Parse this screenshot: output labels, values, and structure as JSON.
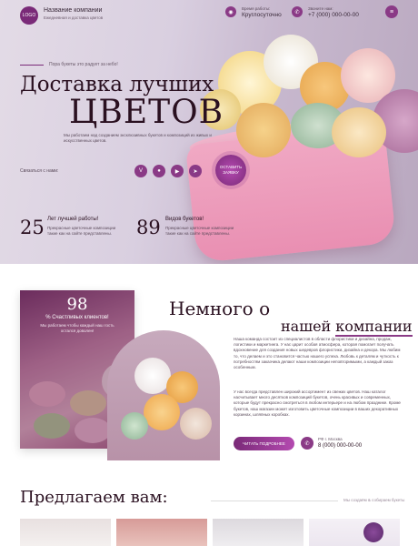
{
  "header": {
    "logo": "LOGO",
    "company_name": "Название компании",
    "company_sub": "Ежедневная и доставка цветов",
    "hours_label": "Время работы:",
    "hours_value": "Круглосуточно",
    "phone_label": "Звоните нам:",
    "phone_value": "+7 (000) 000-00-00"
  },
  "hero": {
    "tagline": "Пора букеты это радует за небо!",
    "title_line1": "Доставка лучших",
    "title_line2": "ЦВЕТОВ",
    "description": "Мы работаем над созданием эксклюзивных букетов и композиций из живых и искусственных цветов.",
    "contact_label": "Связаться с нами:",
    "cta": "ОСТАВИТЬ ЗАЯВКУ",
    "stats": [
      {
        "num": "25",
        "title": "Лет лучшей работы!",
        "desc": "Прекрасные цветочные композиции такие как на сайте представлены."
      },
      {
        "num": "89",
        "title": "Видов букетов!",
        "desc": "Прекрасные цветочные композиции такие как на сайте представлены."
      }
    ]
  },
  "about": {
    "badge_num": "98",
    "badge_title": "% Счастливых клиентов!",
    "badge_desc": "Мы работаем чтобы каждый наш гость остался доволен!",
    "title_line1": "Немного о",
    "title_line2_prefix": "нашей ",
    "title_line2_highlight": "компании",
    "paragraph1": "Наша команда состоит из специалистов в области флористики и дизайна, продаж, логистики и маркетинга. У нас царит особая атмосфера, которая помогает получать вдохновение для создания новых шедевров флористики, дизайна и декора. Мы любим то, что делаем и это становится частью нашего успеха. Любовь к деталям и чуткость к потребностям заказчика делают наши композиции неповторимыми, а каждый заказ особенным.",
    "paragraph2": "У нас всегда представлен широкий ассортимент из свежих цветов. Наш каталог насчитывает много десятков композиций букетов, очень красивых и современных, которые будут прекрасно смотреться в любом интерьере и на любом празднике. Кроме букетов, наш магазин может изготовить цветочные композиции в ваших декоративных корзинах, шляпных коробках.",
    "more_button": "ЧИТАТЬ ПОДРОБНЕЕ",
    "address": "РФ г. Москва",
    "phone": "8 (000) 000-00-00"
  },
  "offer": {
    "title": "Предлагаем вам:",
    "note": "Мы создаём & собираем букеты"
  },
  "social": [
    "vk-icon",
    "chat-icon",
    "youtube-icon",
    "telegram-icon"
  ]
}
